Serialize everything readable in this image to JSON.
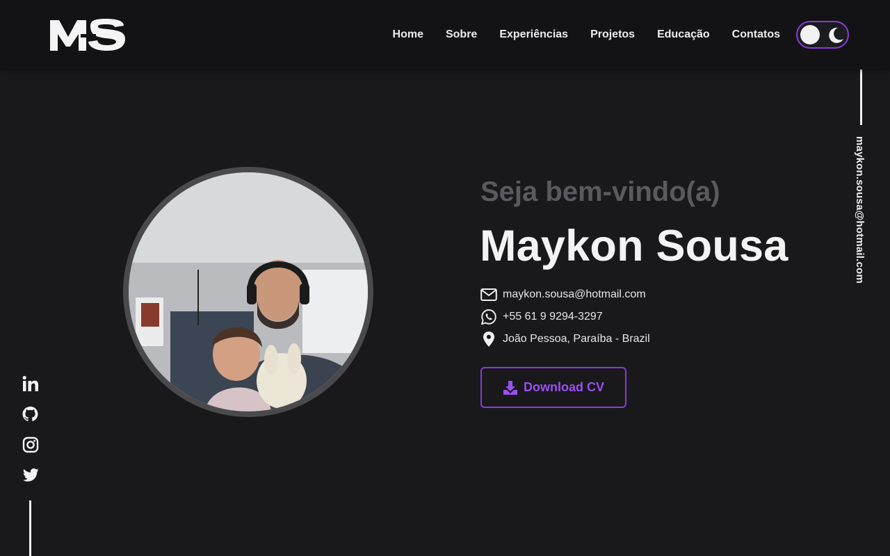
{
  "header": {
    "logo_text": "MS",
    "nav": [
      {
        "label": "Home"
      },
      {
        "label": "Sobre"
      },
      {
        "label": "Experiências"
      },
      {
        "label": "Projetos"
      },
      {
        "label": "Educação"
      },
      {
        "label": "Contatos"
      }
    ],
    "theme_toggle": {
      "icon_on": "sun-knob-icon",
      "icon_off": "moon-icon"
    }
  },
  "side": {
    "vertical_email": "maykon.sousa@hotmail.com",
    "socials": [
      "linkedin-icon",
      "github-icon",
      "instagram-icon",
      "twitter-icon"
    ]
  },
  "hero": {
    "welcome": "Seja bem-vindo(a)",
    "name": "Maykon Sousa",
    "contacts": [
      {
        "icon": "envelope-icon",
        "text": "maykon.sousa@hotmail.com"
      },
      {
        "icon": "whatsapp-icon",
        "text": "+55 61 9 9294-3297"
      },
      {
        "icon": "location-pin-icon",
        "text": "João Pessoa, Paraíba - Brazil"
      }
    ],
    "download_label": "Download CV"
  },
  "colors": {
    "background": "#19181b",
    "header": "#131315",
    "accent": "#8a3bd9",
    "accent_text": "#9b4ff0",
    "muted": "#5a595e"
  }
}
